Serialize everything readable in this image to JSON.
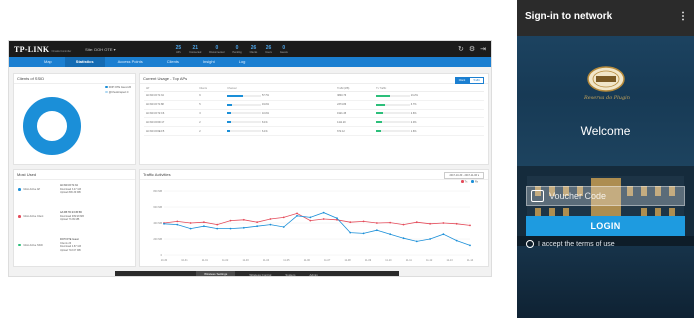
{
  "dashboard": {
    "brand": "TP-LINK",
    "brand_sub": "Omada Controller",
    "site_selector": "Site: DOH OTE ▾",
    "stats": [
      {
        "value": "25",
        "label": "APs"
      },
      {
        "value": "21",
        "label": "Connected"
      },
      {
        "value": "0",
        "label": "Disconnected"
      },
      {
        "value": "0",
        "label": "Pending"
      },
      {
        "value": "26",
        "label": "Clients"
      },
      {
        "value": "26",
        "label": "Users"
      },
      {
        "value": "0",
        "label": "Guests"
      }
    ],
    "top_icons": [
      "refresh-icon",
      "settings-icon",
      "logout-icon"
    ],
    "nav": [
      "Map",
      "Statistics",
      "Access Points",
      "Clients",
      "Insight",
      "Log"
    ],
    "nav_active": 1,
    "clients_panel": {
      "title": "Clients of SSID",
      "legend": [
        {
          "label": "DOH OTE Guest",
          "count": "26",
          "color": "#1b8fd8"
        },
        {
          "label": "@Checkinspect",
          "count": "0",
          "color": "#b0d8f2"
        }
      ],
      "donut_label": "100%",
      "share": 1.0
    },
    "aps_panel": {
      "title": "Current Usage - Top APs",
      "toggle": [
        "Client",
        "Traffic"
      ],
      "toggle_active": 0,
      "headers": [
        "AP",
        "Clients",
        "Channel",
        "Traffic(MB)",
        "Tx Traffic"
      ],
      "rows": [
        {
          "ap": "AC:84:C6:71:34",
          "clients": "9",
          "channel_level": 0.45,
          "channel": "57.7%",
          "traffic": "3840.76",
          "tx_level": 0.4,
          "tx": "13.2%"
        },
        {
          "ap": "AC:84:C6:71:88",
          "clients": "5",
          "channel_level": 0.15,
          "channel": "19.0%",
          "traffic": "2374.86",
          "tx_level": 0.25,
          "tx": "3.7%"
        },
        {
          "ap": "AC:84:C6:72:C6",
          "clients": "3",
          "channel_level": 0.12,
          "channel": "10.0%",
          "traffic": "1921.45",
          "tx_level": 0.2,
          "tx": "2.6%"
        },
        {
          "ap": "AC:84:C6:6D:17",
          "clients": "2",
          "channel_level": 0.1,
          "channel": "8.1%",
          "traffic": "1111.20",
          "tx_level": 0.18,
          "tx": "2.0%"
        },
        {
          "ap": "AC:84:C6:6E:F5",
          "clients": "2",
          "channel_level": 0.08,
          "channel": "6.1%",
          "traffic": "672.12",
          "tx_level": 0.15,
          "tx": "1.6%"
        }
      ]
    },
    "users_panel": {
      "title": "Most Used",
      "rows": [
        {
          "label": "Most Active AP",
          "color": "#1b8fd8",
          "lines": [
            "AC:84:C6:71:34",
            "Download 3.47 GB",
            "Upload 896.39 MB"
          ]
        },
        {
          "label": "Most Active Client",
          "color": "#e44b5a",
          "lines": [
            "AA:FB:7D:23:45:5D",
            "Download 939.98 MB",
            "Upload 73.99 MB"
          ]
        },
        {
          "label": "Most Active SSID",
          "color": "#2cbf7a",
          "lines": [
            "DOH OTE Guest",
            "Clients 26",
            "Download 4.87 GB",
            "Upload 743.67 MB"
          ]
        }
      ]
    },
    "traffic_panel": {
      "title": "Traffic Activities",
      "range": "2017-10-30 - 2017-11-06 ▾",
      "legend": [
        {
          "label": "Tx",
          "color": "#e44b5a"
        },
        {
          "label": "Rx",
          "color": "#1b8fd8"
        }
      ]
    },
    "bottom_bar": [
      "Wireless Settings",
      "Wireless Control",
      "System",
      "Admin"
    ],
    "bottom_active": 0
  },
  "portal": {
    "title": "Sign-in to network",
    "menu_icon": "more-vert-icon",
    "brand_script": "Reserva do Plugin",
    "welcome": "Welcome",
    "voucher_placeholder": "Voucher Code",
    "login_label": "LOGIN",
    "terms_label": "I accept the terms of use"
  },
  "chart_data": {
    "type": "line",
    "title": "",
    "xlabel": "",
    "ylabel": "",
    "ylim": [
      0,
      800
    ],
    "y_ticks": [
      "800 MB",
      "600 MB",
      "400 MB",
      "200 MB",
      "0"
    ],
    "x": [
      "10-30",
      "10-31",
      "11-01",
      "11-02",
      "11-03",
      "11-04",
      "11-05",
      "11-06",
      "11-07",
      "11-08",
      "11-09",
      "11-10",
      "11-11",
      "11-12",
      "11-13",
      "11-14"
    ],
    "series": [
      {
        "name": "Tx",
        "color": "#e44b5a",
        "values": [
          400,
          420,
          400,
          410,
          380,
          430,
          440,
          410,
          450,
          470,
          520,
          430,
          450,
          440,
          410,
          420,
          400,
          405,
          380,
          410,
          390,
          400,
          390,
          370
        ]
      },
      {
        "name": "Rx",
        "color": "#1b8fd8",
        "values": [
          390,
          380,
          330,
          360,
          330,
          330,
          340,
          360,
          380,
          350,
          490,
          470,
          530,
          460,
          280,
          270,
          310,
          260,
          210,
          170,
          200,
          260,
          180,
          120
        ]
      }
    ]
  }
}
